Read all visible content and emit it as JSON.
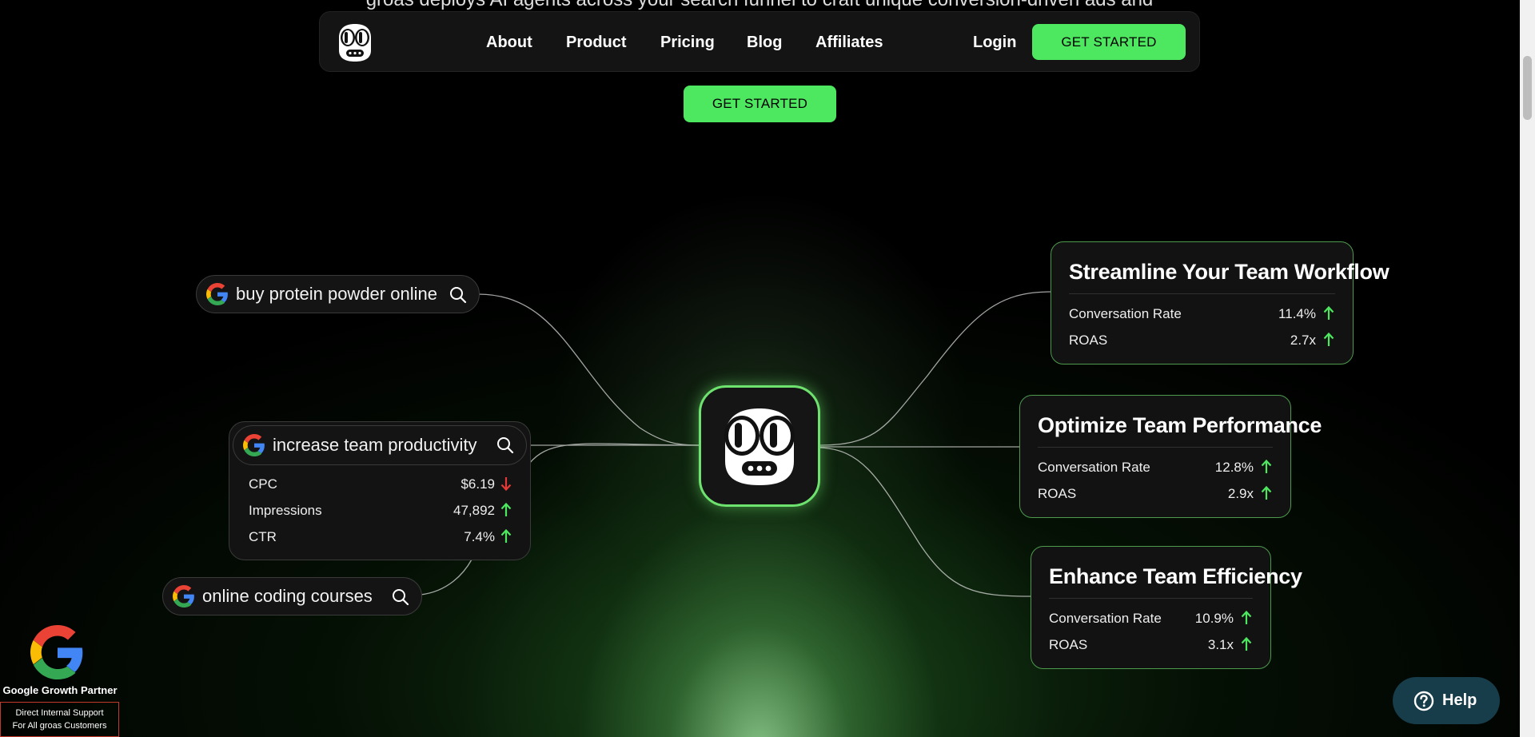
{
  "hero": {
    "partial_text": "groas deploys AI agents across your search funnel to craft unique conversion-driven ads and",
    "cta_label": "GET STARTED"
  },
  "nav": {
    "logo": "groas-mascot-icon",
    "links": [
      "About",
      "Product",
      "Pricing",
      "Blog",
      "Affiliates"
    ],
    "login_label": "Login",
    "cta_label": "GET STARTED"
  },
  "searches": [
    {
      "query": "buy protein powder online"
    },
    {
      "query": "increase team productivity",
      "metrics": [
        {
          "label": "CPC",
          "value": "$6.19",
          "trend": "down"
        },
        {
          "label": "Impressions",
          "value": "47,892",
          "trend": "up"
        },
        {
          "label": "CTR",
          "value": "7.4%",
          "trend": "up"
        }
      ]
    },
    {
      "query": "online coding courses"
    }
  ],
  "results": [
    {
      "title": "Streamline Your Team Workflow",
      "metrics": [
        {
          "label": "Conversation Rate",
          "value": "11.4%",
          "trend": "up"
        },
        {
          "label": "ROAS",
          "value": "2.7x",
          "trend": "up"
        }
      ]
    },
    {
      "title": "Optimize Team Performance",
      "metrics": [
        {
          "label": "Conversation Rate",
          "value": "12.8%",
          "trend": "up"
        },
        {
          "label": "ROAS",
          "value": "2.9x",
          "trend": "up"
        }
      ]
    },
    {
      "title": "Enhance Team Efficiency",
      "metrics": [
        {
          "label": "Conversation Rate",
          "value": "10.9%",
          "trend": "up"
        },
        {
          "label": "ROAS",
          "value": "3.1x",
          "trend": "up"
        }
      ]
    }
  ],
  "badge": {
    "title": "Google Growth Partner",
    "line1": "Direct Internal Support",
    "line2": "For All groas Customers"
  },
  "help": {
    "label": "Help"
  },
  "colors": {
    "accent_green": "#4ee860",
    "trend_up": "#4ee860",
    "trend_down": "#e53935",
    "help_bg": "#173c4a"
  }
}
